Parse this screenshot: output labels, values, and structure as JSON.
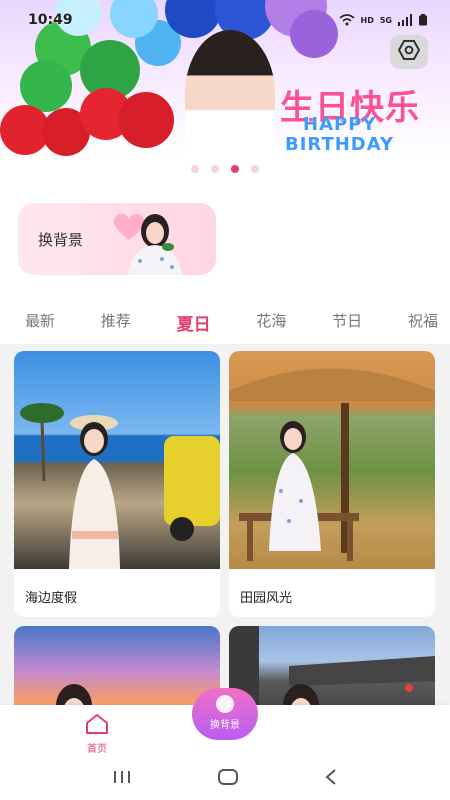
{
  "status_bar": {
    "time": "10:49",
    "network_hd": "HD",
    "network_5g": "5G"
  },
  "banner": {
    "headline": "生日快乐",
    "line2": "HAPPY",
    "line3": "BIRTHDAY",
    "dots_count": 4,
    "active_dot_index": 2
  },
  "bg_card": {
    "label": "换背景"
  },
  "tabs": [
    {
      "label": "最新",
      "active": false
    },
    {
      "label": "推荐",
      "active": false
    },
    {
      "label": "夏日",
      "active": true
    },
    {
      "label": "花海",
      "active": false
    },
    {
      "label": "节日",
      "active": false
    },
    {
      "label": "祝福",
      "active": false
    }
  ],
  "grid": [
    {
      "title": "海边度假"
    },
    {
      "title": "田园风光"
    }
  ],
  "bottom_nav": {
    "home_label": "首页",
    "fab_label": "换背景"
  },
  "colors": {
    "accent": "#e53d6a",
    "fab_start": "#f071c6",
    "fab_end": "#b85df2"
  }
}
